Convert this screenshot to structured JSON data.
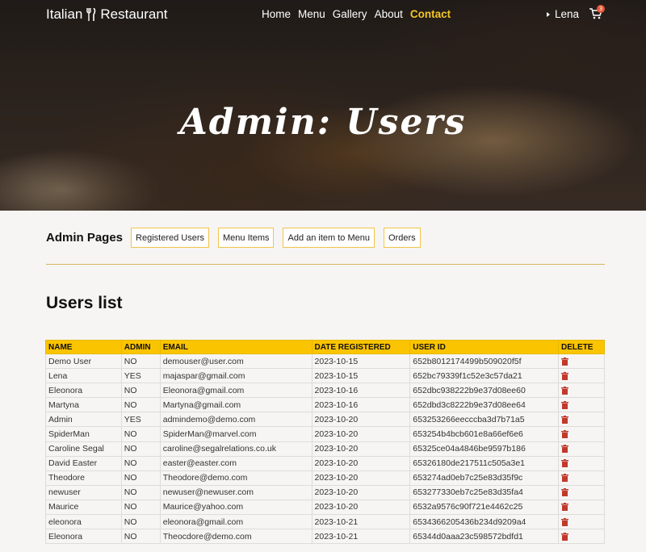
{
  "nav": {
    "logo_left": "Italian",
    "logo_right": "Restaurant",
    "links": [
      "Home",
      "Menu",
      "Gallery",
      "About",
      "Contact"
    ],
    "active_link": "Contact",
    "user_name": "Lena",
    "cart_count": "3"
  },
  "hero": {
    "title": "Admin: Users"
  },
  "admin": {
    "heading": "Admin Pages",
    "buttons": [
      "Registered Users",
      "Menu Items",
      "Add an item to Menu",
      "Orders"
    ]
  },
  "users": {
    "title": "Users list",
    "columns": [
      "NAME",
      "ADMIN",
      "EMAIL",
      "DATE REGISTERED",
      "USER ID",
      "DELETE"
    ],
    "rows": [
      [
        "Demo User",
        "NO",
        "demouser@user.com",
        "2023-10-15",
        "652b8012174499b509020f5f"
      ],
      [
        "Lena",
        "YES",
        "majaspar@gmail.com",
        "2023-10-15",
        "652bc79339f1c52e3c57da21"
      ],
      [
        "Eleonora",
        "NO",
        "Eleonora@gmail.com",
        "2023-10-16",
        "652dbc938222b9e37d08ee60"
      ],
      [
        "Martyna",
        "NO",
        "Martyna@gmail.com",
        "2023-10-16",
        "652dbd3c8222b9e37d08ee64"
      ],
      [
        "Admin",
        "YES",
        "admindemo@demo.com",
        "2023-10-20",
        "653253266eecccba3d7b71a5"
      ],
      [
        "SpiderMan",
        "NO",
        "SpiderMan@marvel.com",
        "2023-10-20",
        "653254b4bcb601e8a66ef6e6"
      ],
      [
        "Caroline Segal",
        "NO",
        "caroline@segalrelations.co.uk",
        "2023-10-20",
        "65325ce04a4846be9597b186"
      ],
      [
        "David Easter",
        "NO",
        "easter@easter.com",
        "2023-10-20",
        "65326180de217511c505a3e1"
      ],
      [
        "Theodore",
        "NO",
        "Theodore@demo.com",
        "2023-10-20",
        "653274ad0eb7c25e83d35f9c"
      ],
      [
        "newuser",
        "NO",
        "newuser@newuser.com",
        "2023-10-20",
        "653277330eb7c25e83d35fa4"
      ],
      [
        "Maurice",
        "NO",
        "Maurice@yahoo.com",
        "2023-10-20",
        "6532a9576c90f721e4462c25"
      ],
      [
        "eleonora",
        "NO",
        "eleonora@gmail.com",
        "2023-10-21",
        "6534366205436b234d9209a4"
      ],
      [
        "Eleonora",
        "NO",
        "Theocdore@demo.com",
        "2023-10-21",
        "65344d0aaa23c598572bdfd1"
      ]
    ]
  },
  "colors": {
    "accent": "#fbc400",
    "active_link": "#f3c623",
    "delete_icon": "#c0392b"
  }
}
